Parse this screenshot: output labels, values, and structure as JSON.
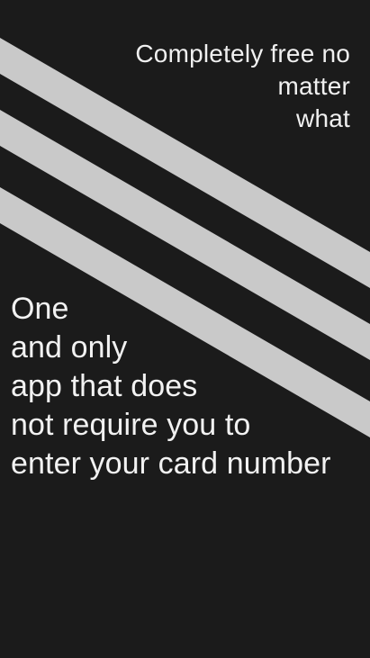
{
  "colors": {
    "background": "#1b1b1b",
    "stripe": "#c9c9c9",
    "text": "#f2f2f2"
  },
  "promo": {
    "headline_lines": [
      "Completely free no",
      "matter",
      "what"
    ]
  },
  "message": {
    "lines": [
      "One",
      "and only",
      "app that does",
      "not require you to",
      "enter your card number"
    ]
  }
}
